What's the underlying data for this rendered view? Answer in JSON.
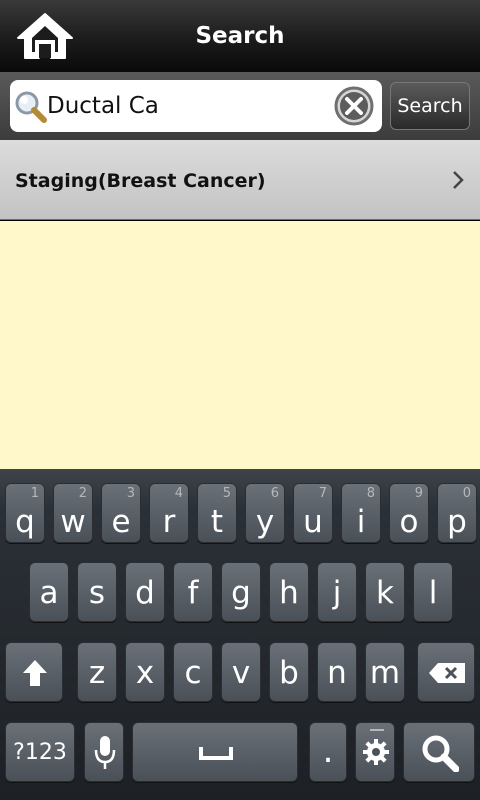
{
  "titlebar": {
    "title": "Search",
    "home_icon": "home-icon"
  },
  "search": {
    "query": "Ductal Ca",
    "button_label": "Search"
  },
  "results": [
    {
      "label": "Staging(Breast Cancer)"
    }
  ],
  "keyboard": {
    "row1": [
      {
        "key": "q",
        "num": "1"
      },
      {
        "key": "w",
        "num": "2"
      },
      {
        "key": "e",
        "num": "3"
      },
      {
        "key": "r",
        "num": "4"
      },
      {
        "key": "t",
        "num": "5"
      },
      {
        "key": "y",
        "num": "6"
      },
      {
        "key": "u",
        "num": "7"
      },
      {
        "key": "i",
        "num": "8"
      },
      {
        "key": "o",
        "num": "9"
      },
      {
        "key": "p",
        "num": "0"
      }
    ],
    "row2": [
      "a",
      "s",
      "d",
      "f",
      "g",
      "h",
      "j",
      "k",
      "l"
    ],
    "row3": [
      "z",
      "x",
      "c",
      "v",
      "b",
      "n",
      "m"
    ],
    "symbols_label": "?123",
    "period_label": "."
  }
}
